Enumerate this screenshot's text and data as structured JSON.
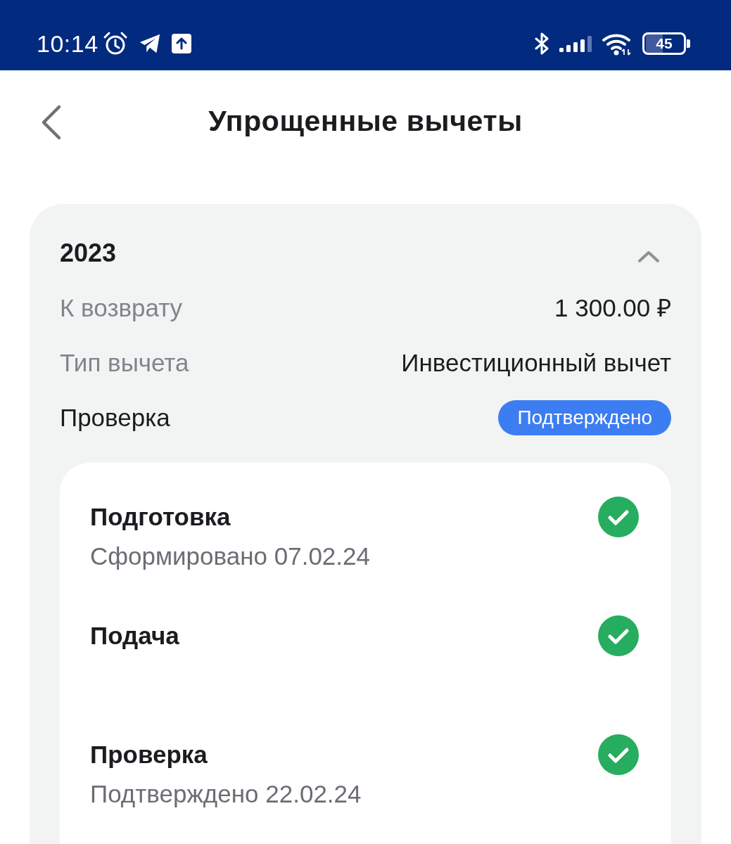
{
  "status_bar": {
    "time": "10:14",
    "battery": "45"
  },
  "header": {
    "title": "Упрощенные вычеты"
  },
  "deduction": {
    "year": "2023",
    "expanded": true,
    "fields": [
      {
        "label": "К возврату",
        "value": "1 300.00 ₽"
      },
      {
        "label": "Тип вычета",
        "value": "Инвестиционный вычет"
      }
    ],
    "check": {
      "label": "Проверка",
      "status": "Подтверждено"
    },
    "steps": [
      {
        "title": "Подготовка",
        "note": "Сформировано 07.02.24",
        "done": true
      },
      {
        "title": "Подача",
        "done": true
      },
      {
        "title": "Проверка",
        "note": "Подтверждено 22.02.24",
        "done": true
      }
    ]
  }
}
